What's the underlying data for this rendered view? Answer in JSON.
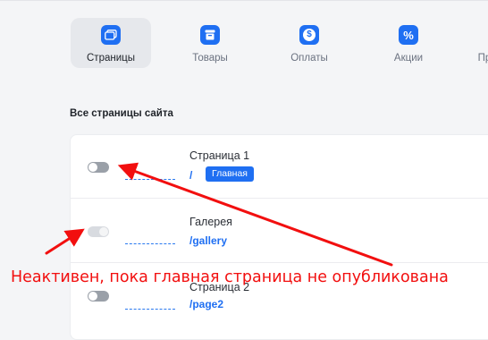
{
  "tabs": [
    {
      "label": "Страницы",
      "icon": "pages-icon",
      "active": true
    },
    {
      "label": "Товары",
      "icon": "products-icon",
      "active": false
    },
    {
      "label": "Оплаты",
      "icon": "dollar-icon",
      "active": false
    },
    {
      "label": "Акции",
      "icon": "percent-icon",
      "active": false
    },
    {
      "label": "Пр",
      "icon": "",
      "active": false
    }
  ],
  "icons": {
    "dollar_glyph": "$",
    "percent_glyph": "%"
  },
  "section": {
    "title": "Все страницы сайта"
  },
  "pages": [
    {
      "title": "Страница 1",
      "link": "/",
      "badge": "Главная",
      "toggle_enabled": true
    },
    {
      "title": "Галерея",
      "link": "/gallery",
      "toggle_enabled": false
    },
    {
      "title": "Страница 2",
      "link": "/page2",
      "toggle_enabled": true
    }
  ],
  "annotation": {
    "text": "Неактивен, пока главная страница не опубликована",
    "color": "#f20f0f"
  },
  "colors": {
    "accent": "#1f6ff2",
    "annotation": "#f20f0f"
  }
}
